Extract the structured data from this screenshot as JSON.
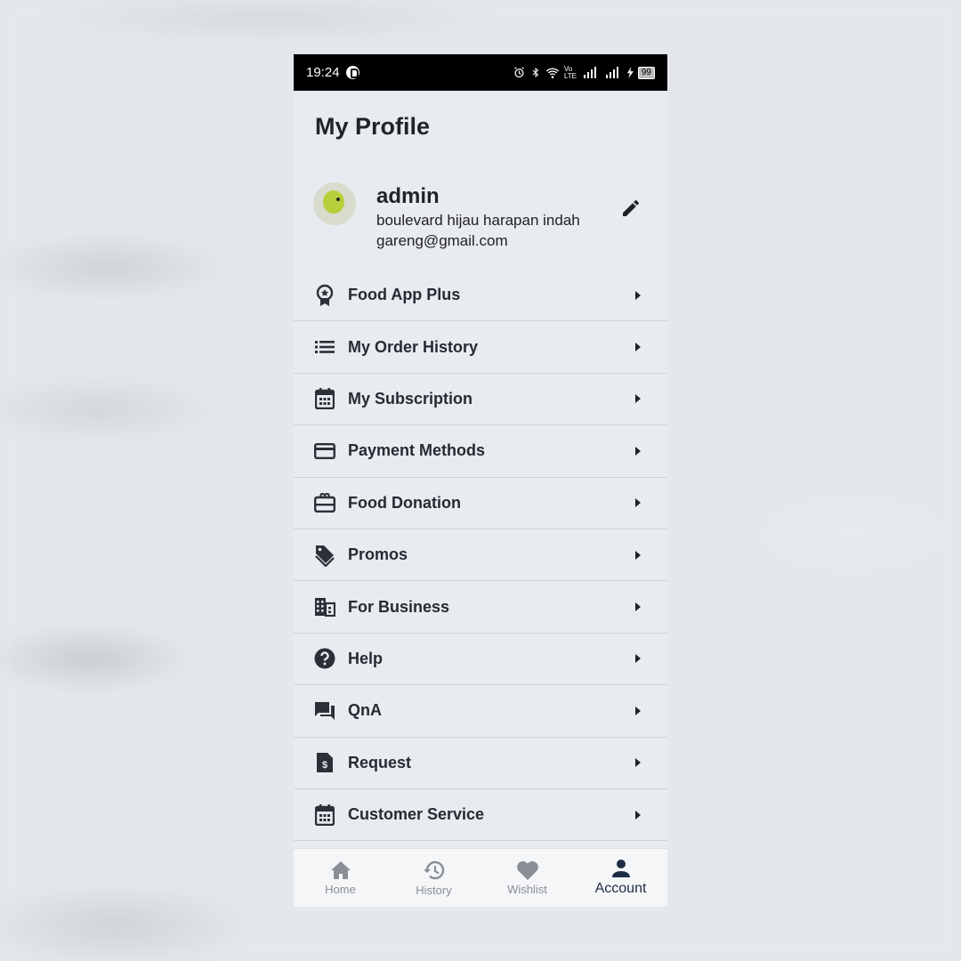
{
  "statusbar": {
    "time": "19:24",
    "battery": "99",
    "network": "Vo LTE"
  },
  "page": {
    "title": "My Profile"
  },
  "profile": {
    "name": "admin",
    "address": "boulevard hijau harapan indah",
    "email": "gareng@gmail.com"
  },
  "menu": {
    "items": [
      {
        "label": "Food App Plus",
        "icon": "badge-star-icon"
      },
      {
        "label": "My Order History",
        "icon": "list-icon"
      },
      {
        "label": "My Subscription",
        "icon": "calendar-icon"
      },
      {
        "label": "Payment Methods",
        "icon": "credit-card-icon"
      },
      {
        "label": "Food Donation",
        "icon": "gift-card-icon"
      },
      {
        "label": "Promos",
        "icon": "tag-icon"
      },
      {
        "label": "For Business",
        "icon": "building-icon"
      },
      {
        "label": "Help",
        "icon": "help-circle-icon"
      },
      {
        "label": "QnA",
        "icon": "chat-icon"
      },
      {
        "label": "Request",
        "icon": "invoice-icon"
      },
      {
        "label": "Customer Service",
        "icon": "calendar-icon"
      }
    ]
  },
  "nav": {
    "home": "Home",
    "history": "History",
    "wishlist": "Wishlist",
    "account": "Account",
    "active": "account"
  },
  "colors": {
    "active_nav": "#1d2d44",
    "inactive_nav": "#8a8f96",
    "icon": "#2b3038"
  }
}
